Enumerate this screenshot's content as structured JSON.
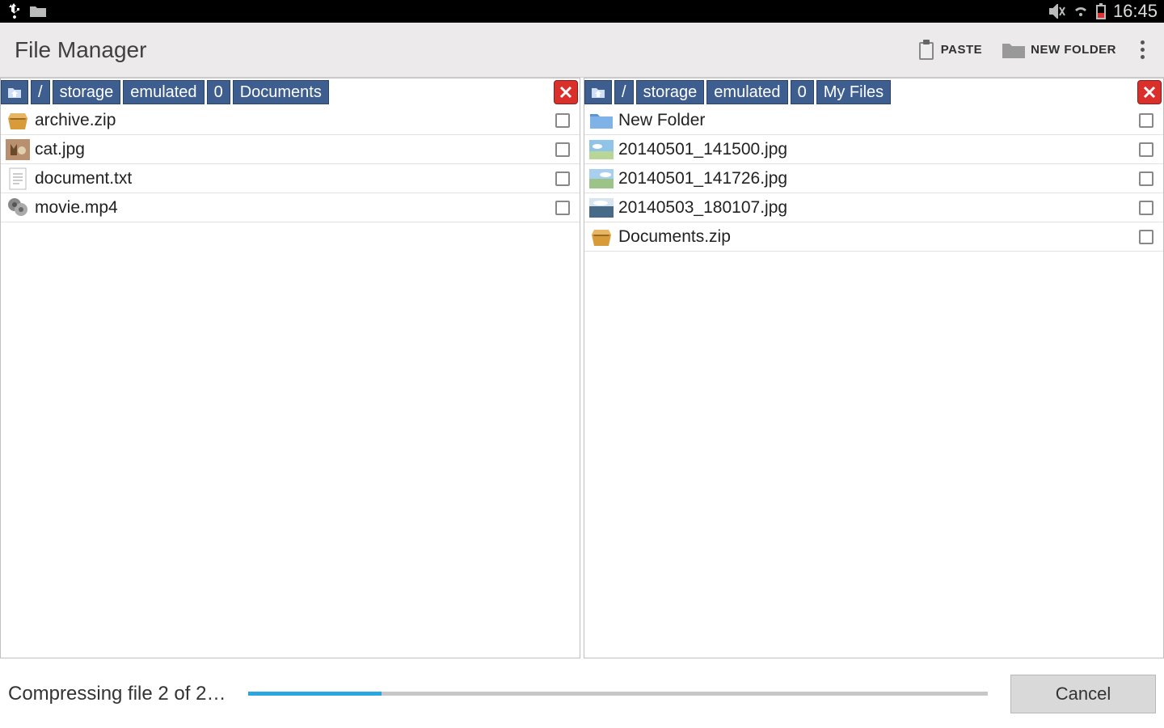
{
  "status": {
    "time": "16:45"
  },
  "actionbar": {
    "title": "File Manager",
    "paste": "PASTE",
    "new_folder": "NEW FOLDER"
  },
  "panes": [
    {
      "crumbs": [
        "/",
        "storage",
        "emulated",
        "0",
        "Documents"
      ],
      "files": [
        {
          "name": "archive.zip",
          "icon": "zip"
        },
        {
          "name": "cat.jpg",
          "icon": "img-cat"
        },
        {
          "name": "document.txt",
          "icon": "txt"
        },
        {
          "name": "movie.mp4",
          "icon": "film"
        }
      ]
    },
    {
      "crumbs": [
        "/",
        "storage",
        "emulated",
        "0",
        "My Files"
      ],
      "files": [
        {
          "name": "New Folder",
          "icon": "folder"
        },
        {
          "name": "20140501_141500.jpg",
          "icon": "img-sky"
        },
        {
          "name": "20140501_141726.jpg",
          "icon": "img-sky2"
        },
        {
          "name": "20140503_180107.jpg",
          "icon": "img-sea"
        },
        {
          "name": "Documents.zip",
          "icon": "zip"
        }
      ]
    }
  ],
  "progress": {
    "text": "Compressing file 2 of 2…",
    "percent": 18,
    "cancel": "Cancel"
  },
  "colors": {
    "crumb_bg": "#3e5e8f",
    "close_bg": "#d9302b",
    "progress_fill": "#2aa6e0"
  }
}
